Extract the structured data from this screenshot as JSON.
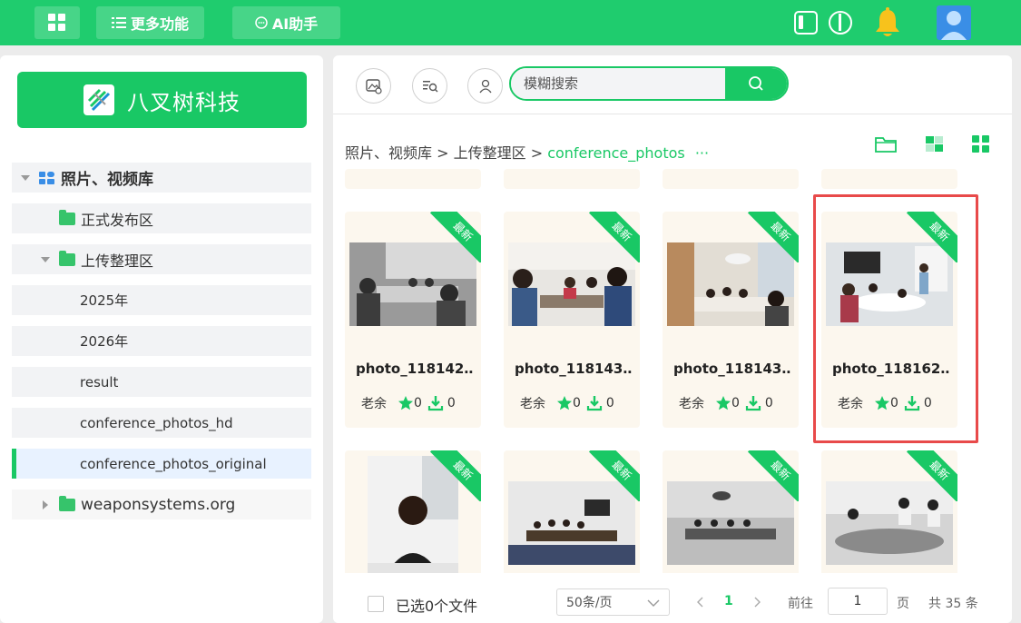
{
  "topbar": {
    "more_label": "更多功能",
    "ai_label": "AI助手"
  },
  "sidebar": {
    "brand": "八叉树科技",
    "tree": [
      {
        "label": "照片、视频库"
      },
      {
        "label": "正式发布区"
      },
      {
        "label": "上传整理区"
      },
      {
        "label": "2025年"
      },
      {
        "label": "2026年"
      },
      {
        "label": "result"
      },
      {
        "label": "conference_photos_hd"
      },
      {
        "label": "conference_photos_original"
      },
      {
        "label": "weaponsystems.org"
      }
    ]
  },
  "search": {
    "placeholder": "模糊搜索"
  },
  "breadcrumb": {
    "part1": "照片、视频库",
    "sep": " > ",
    "part2": "上传整理区",
    "part3": "conference_photos",
    "more": "···"
  },
  "ribbon_label": "最新",
  "cards": [
    {
      "name": "photo_118142…",
      "owner": "老余",
      "likes": "0",
      "downloads": "0"
    },
    {
      "name": "photo_118143…",
      "owner": "老余",
      "likes": "0",
      "downloads": "0"
    },
    {
      "name": "photo_118143…",
      "owner": "老余",
      "likes": "0",
      "downloads": "0"
    },
    {
      "name": "photo_118162…",
      "owner": "老余",
      "likes": "0",
      "downloads": "0"
    }
  ],
  "footer": {
    "selected": "已选0个文件",
    "page_size": "50条/页",
    "current_page": "1",
    "goto_label": "前往",
    "goto_value": "1",
    "page_unit": "页",
    "total": "共 35 条"
  },
  "colors": {
    "brand_green": "#19c865",
    "highlight_red": "#e84a4a",
    "card_bg": "#fcf7ee"
  }
}
